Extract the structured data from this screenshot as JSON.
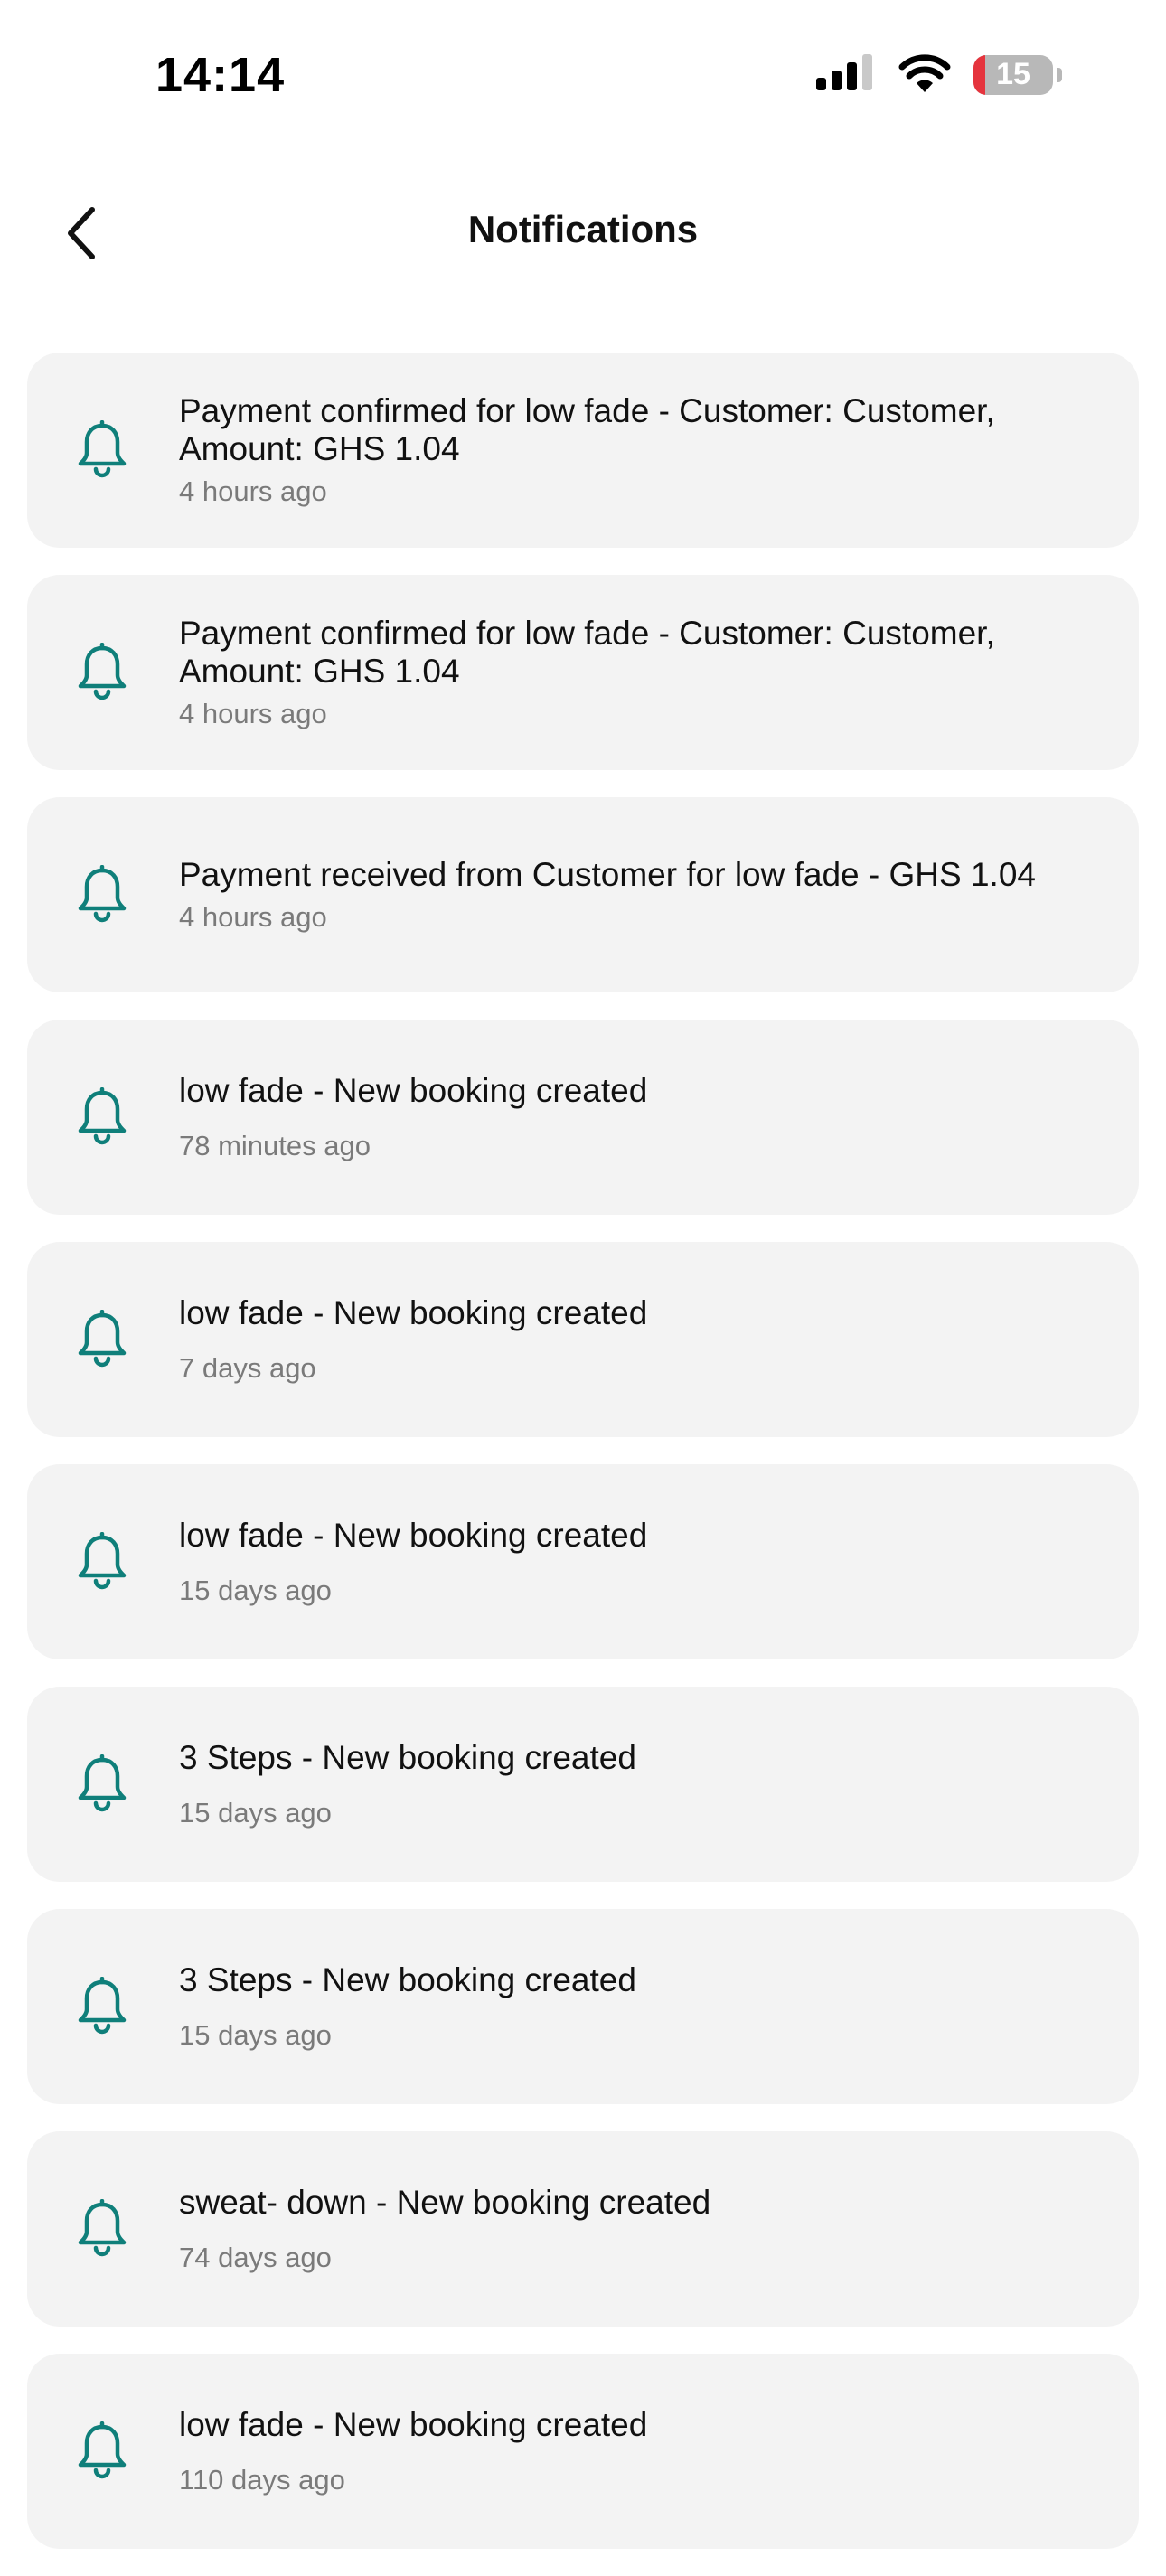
{
  "status_bar": {
    "time": "14:14",
    "battery_level": "15",
    "battery_fraction": 0.15,
    "battery_color": "#e5343d"
  },
  "header": {
    "title": "Notifications",
    "back_icon": "chevron-left-icon"
  },
  "theme": {
    "icon_color": "#0f7f7a",
    "card_bg": "#f3f3f3"
  },
  "notifications": [
    {
      "message": "Payment confirmed for low fade - Customer: Customer, Amount: GHS 1.04",
      "time": "4 hours ago",
      "icon": "bell-icon"
    },
    {
      "message": "Payment confirmed for low fade - Customer: Customer, Amount: GHS 1.04",
      "time": "4 hours ago",
      "icon": "bell-icon"
    },
    {
      "message": "Payment received from Customer for low fade - GHS 1.04",
      "time": "4 hours ago",
      "icon": "bell-icon"
    },
    {
      "message": "low fade - New booking created",
      "time": "78 minutes ago",
      "icon": "bell-icon"
    },
    {
      "message": "low fade - New booking created",
      "time": "7 days ago",
      "icon": "bell-icon"
    },
    {
      "message": "low fade - New booking created",
      "time": "15 days ago",
      "icon": "bell-icon"
    },
    {
      "message": "3 Steps - New booking created",
      "time": "15 days ago",
      "icon": "bell-icon"
    },
    {
      "message": "3 Steps - New booking created",
      "time": "15 days ago",
      "icon": "bell-icon"
    },
    {
      "message": "sweat- down - New booking created",
      "time": "74 days ago",
      "icon": "bell-icon"
    },
    {
      "message": "low fade - New booking created",
      "time": "110 days ago",
      "icon": "bell-icon"
    }
  ]
}
